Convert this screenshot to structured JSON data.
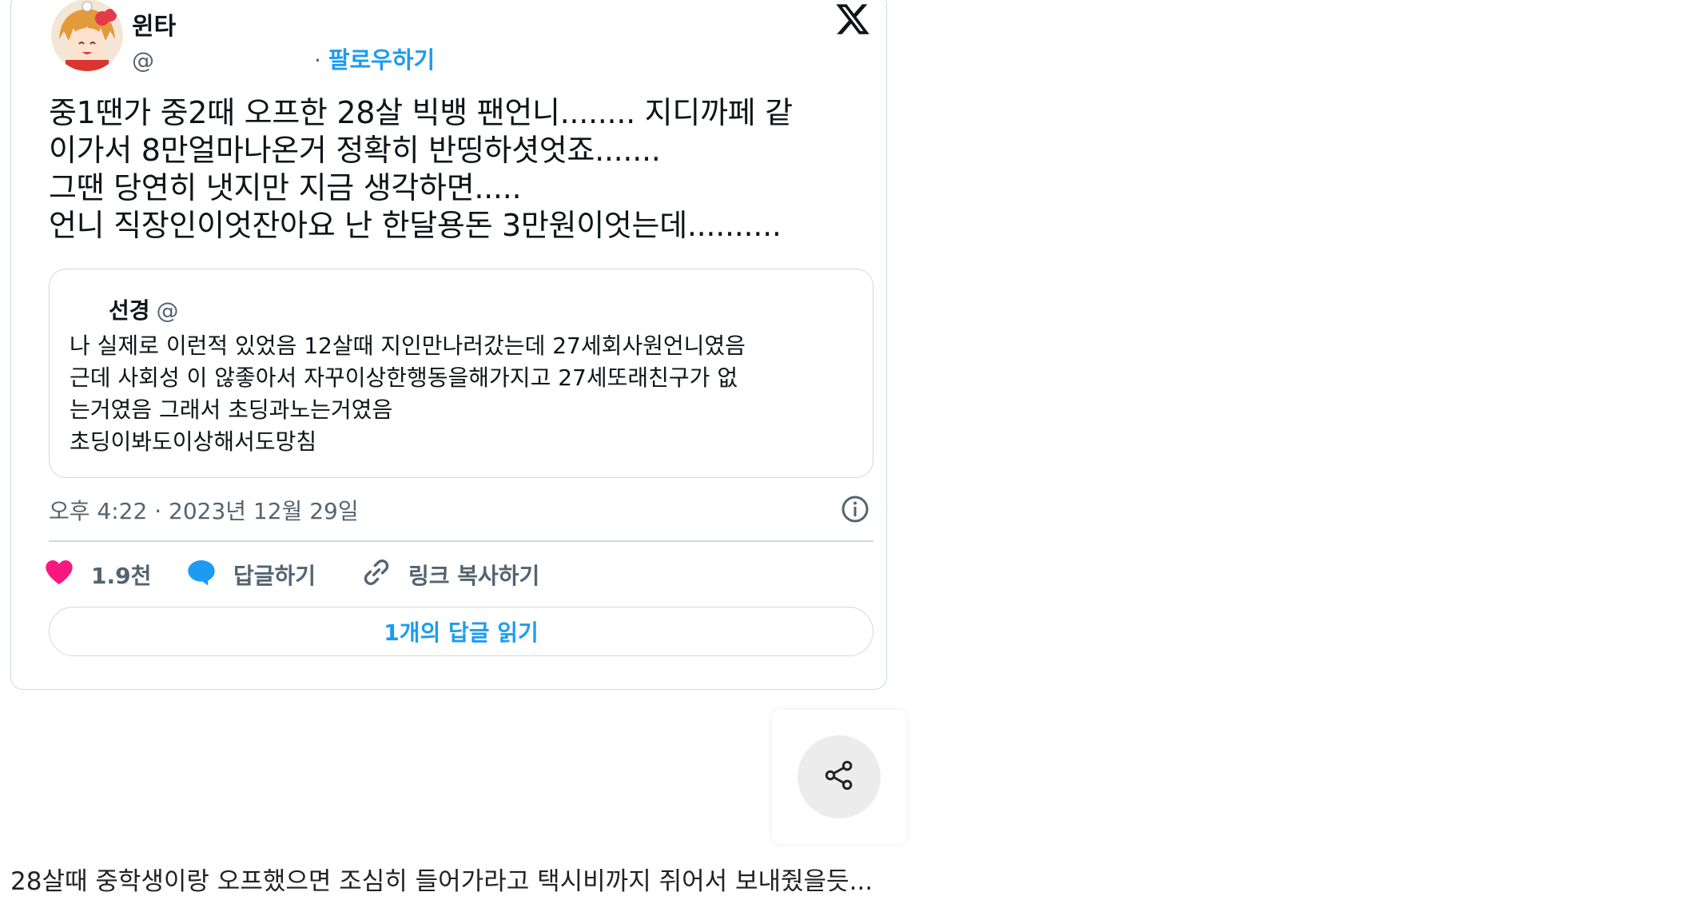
{
  "tweet": {
    "author_name": "윈타",
    "handle_prefix": "@",
    "separator": "·",
    "follow_label": "팔로우하기",
    "text": "중1땐가 중2때 오프한 28살 빅뱅 팬언니........ 지디까페 같\n이가서 8만얼마나온거 정확히 반띵하셧엇죠.......\n그땐 당연히 냇지만 지금 생각하면.....\n언니 직장인이엇잔아요 난 한달용돈 3만원이엇는데..........",
    "quote": {
      "name": "선경",
      "handle": "@",
      "text": "나 실제로 이런적 있었음 12살때 지인만나러갔는데 27세회사원언니였음\n근데 사회성 이 않좋아서 자꾸이상한행동을해가지고 27세또래친구가 없\n는거였음 그래서 초딩과노는거였음\n초딩이봐도이상해서도망침"
    },
    "timestamp": "오후 4:22 · 2023년 12월 29일",
    "actions": {
      "like_count": "1.9천",
      "reply_label": "답글하기",
      "copy_link_label": "링크 복사하기"
    },
    "read_replies_label": "1개의 답글 읽기"
  },
  "colors": {
    "accent": "#1d9bf0",
    "like": "#f91880",
    "muted": "#536471",
    "border": "#cfd9de"
  },
  "icons": {
    "x_logo": "x-logo-icon",
    "info": "info-icon",
    "like": "heart-icon",
    "reply": "speech-bubble-icon",
    "link": "link-icon",
    "share": "share-icon"
  },
  "bottom_comment": "28살때 중학생이랑 오프했으면 조심히 들어가라고 택시비까지 쥐어서 보내줬을듯..."
}
